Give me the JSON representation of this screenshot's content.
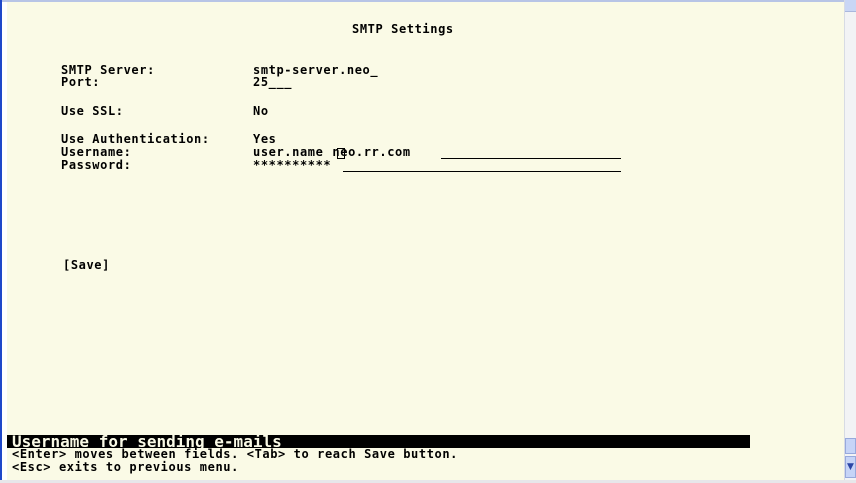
{
  "screen": {
    "title": "SMTP Settings",
    "fields": {
      "smtp_server": {
        "label": "SMTP Server:",
        "value": "smtp-server.neo_"
      },
      "port": {
        "label": "Port:",
        "value": "25___"
      },
      "use_ssl": {
        "label": "Use SSL:",
        "value": "No"
      },
      "use_auth": {
        "label": "Use Authentication:",
        "value": "Yes"
      },
      "username": {
        "label": "Username:",
        "value_before_cursor": "user.name",
        "value_after_cursor": "neo.rr.com"
      },
      "password": {
        "label": "Password:",
        "value": "**********"
      }
    },
    "save_label": "[Save]"
  },
  "status_bar": {
    "hint": "Username for sending e-mails",
    "help_line1": "<Enter> moves between fields. <Tab> to reach Save button.",
    "help_line2": "<Esc> exits to previous menu."
  },
  "scrollbar": {
    "down_arrow": "▼"
  }
}
